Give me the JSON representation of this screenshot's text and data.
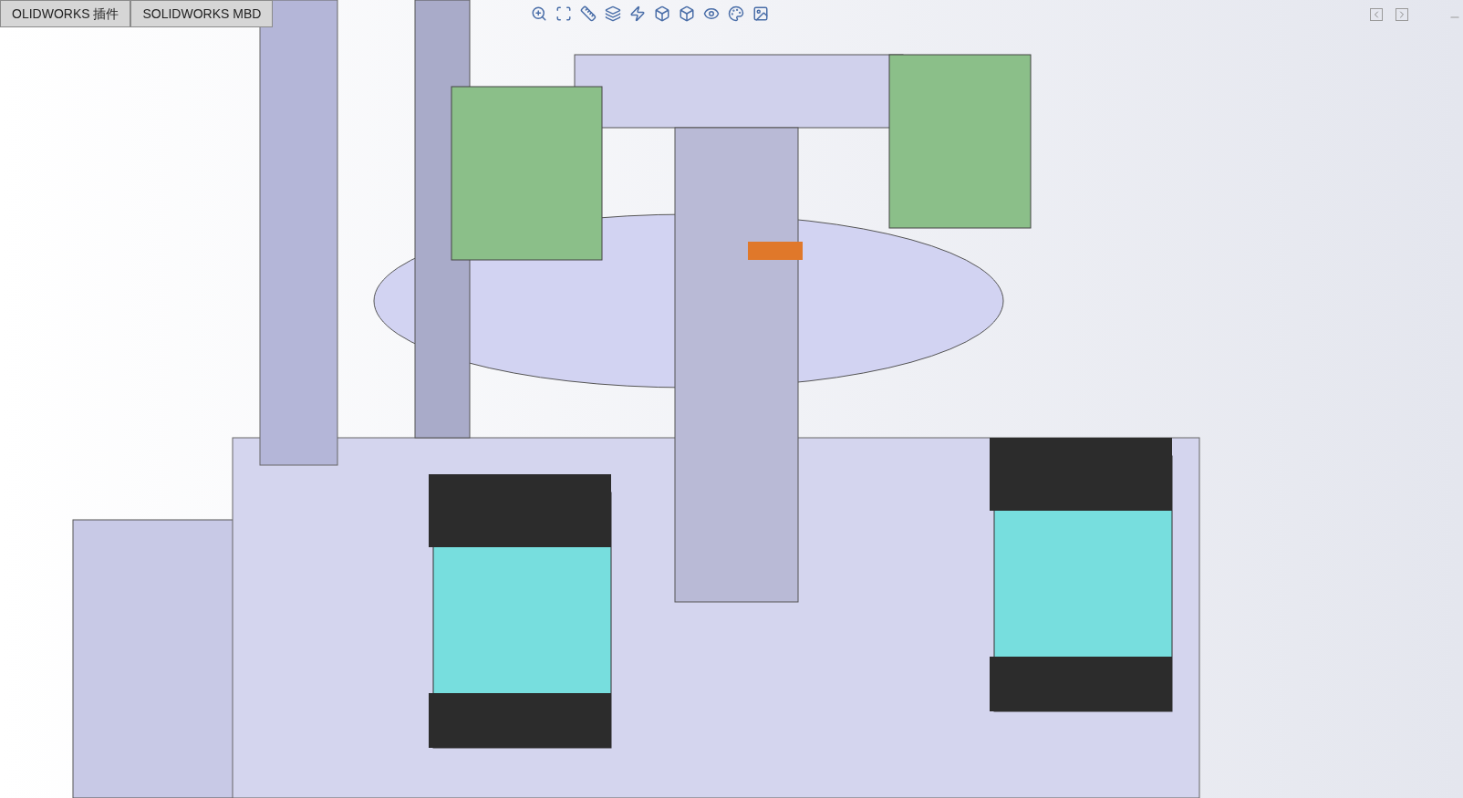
{
  "tabs": [
    {
      "label": "OLIDWORKS 插件"
    },
    {
      "label": "SOLIDWORKS MBD"
    }
  ]
}
